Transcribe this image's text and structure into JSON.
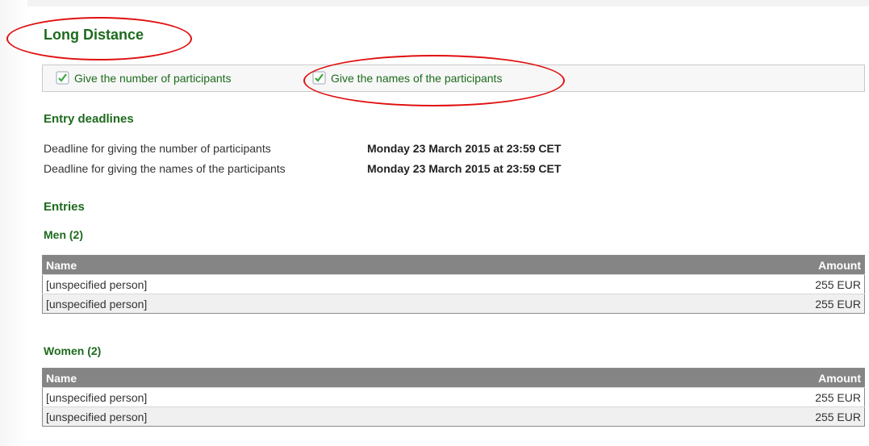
{
  "title": "Long Distance",
  "actions": [
    {
      "label": "Give the number of participants",
      "icon": "checkmark-icon"
    },
    {
      "label": "Give the names of the participants",
      "icon": "checkmark-icon"
    }
  ],
  "deadlines": {
    "heading": "Entry deadlines",
    "rows": [
      {
        "label": "Deadline for giving the number of participants",
        "value": "Monday 23 March 2015 at 23:59 CET"
      },
      {
        "label": "Deadline for giving the names of the participants",
        "value": "Monday 23 March 2015 at 23:59 CET"
      }
    ]
  },
  "entries": {
    "heading": "Entries",
    "columns": {
      "name": "Name",
      "amount": "Amount"
    },
    "groups": [
      {
        "title": "Men (2)",
        "rows": [
          {
            "name": "[unspecified person]",
            "amount": "255 EUR"
          },
          {
            "name": "[unspecified person]",
            "amount": "255 EUR"
          }
        ]
      },
      {
        "title": "Women (2)",
        "rows": [
          {
            "name": "[unspecified person]",
            "amount": "255 EUR"
          },
          {
            "name": "[unspecified person]",
            "amount": "255 EUR"
          }
        ]
      }
    ]
  },
  "colors": {
    "heading": "#1e6b1e",
    "table_header": "#858585",
    "annotation": "#e01010"
  }
}
